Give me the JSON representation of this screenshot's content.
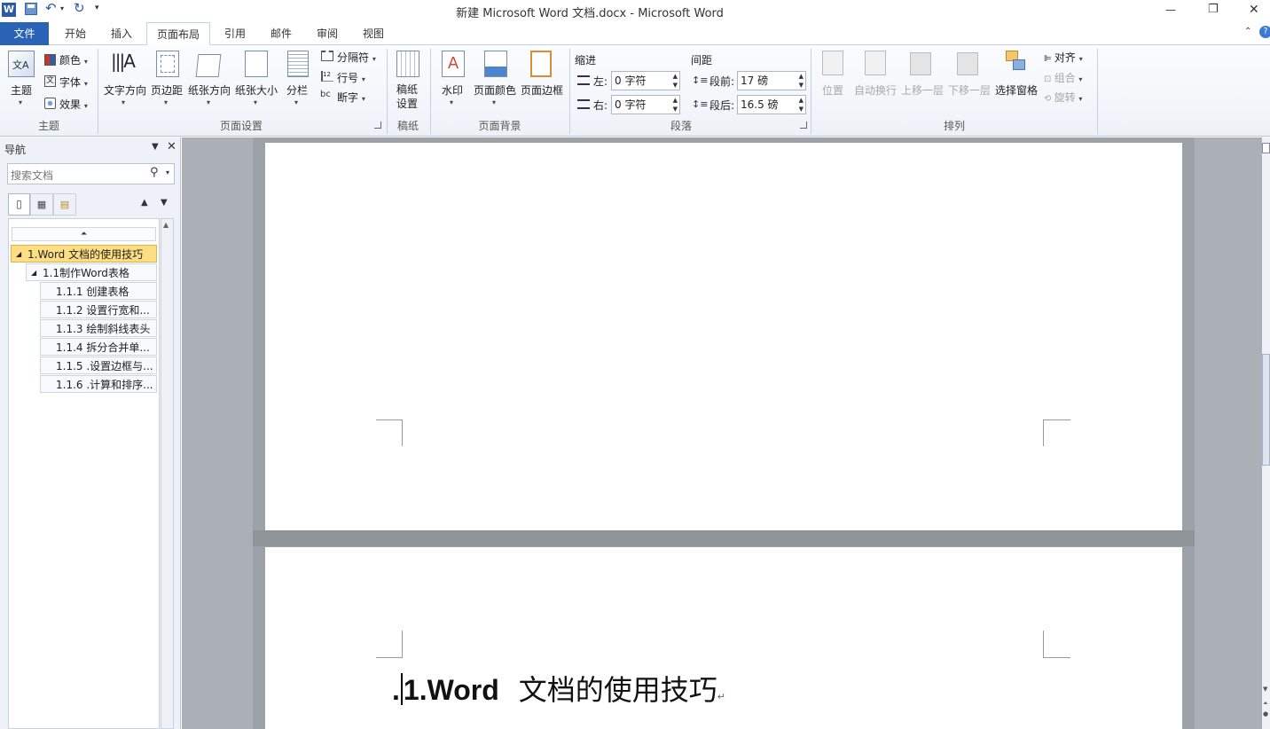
{
  "window": {
    "title": "新建 Microsoft Word 文档.docx  -  Microsoft Word",
    "controls": {
      "minimize": "—",
      "restore": "❐",
      "close": "✕"
    }
  },
  "quick_access": {
    "app_icon": "W",
    "save_icon": "save-icon",
    "undo_icon": "undo-icon",
    "redo_icon": "redo-icon"
  },
  "tabs": [
    "文件",
    "开始",
    "插入",
    "页面布局",
    "引用",
    "邮件",
    "审阅",
    "视图"
  ],
  "ribbon": {
    "theme": {
      "themes": "主题",
      "colors": "颜色",
      "fonts": "字体",
      "effects": "效果",
      "group": "主题"
    },
    "page_setup": {
      "text_direction": "文字方向",
      "margins": "页边距",
      "orientation": "纸张方向",
      "size": "纸张大小",
      "columns": "分栏",
      "breaks": "分隔符",
      "line_numbers": "行号",
      "hyphenation": "断字",
      "group": "页面设置"
    },
    "manuscript": {
      "setup_line1": "稿纸",
      "setup_line2": "设置",
      "group": "稿纸"
    },
    "page_background": {
      "watermark": "水印",
      "page_color": "页面颜色",
      "page_borders": "页面边框",
      "group": "页面背景"
    },
    "paragraph": {
      "indent_title": "缩进",
      "indent_left_label": "左:",
      "indent_left_value": "0 字符",
      "indent_right_label": "右:",
      "indent_right_value": "0 字符",
      "spacing_title": "间距",
      "spacing_before_label": "段前:",
      "spacing_before_value": "17 磅",
      "spacing_after_label": "段后:",
      "spacing_after_value": "16.5 磅",
      "group": "段落"
    },
    "arrange": {
      "position": "位置",
      "wrap_text": "自动换行",
      "bring_forward": "上移一层",
      "send_backward": "下移一层",
      "selection_pane": "选择窗格",
      "align": "对齐",
      "group_objects": "组合",
      "rotate": "旋转",
      "group": "排列"
    }
  },
  "nav_pane": {
    "title": "导航",
    "search_placeholder": "搜索文档",
    "headings": [
      {
        "level": 1,
        "text": "1.Word 文档的使用技巧",
        "selected": true
      },
      {
        "level": 2,
        "text": "1.1制作Word表格",
        "selected": false
      },
      {
        "level": 3,
        "text": "1.1.1 创建表格",
        "selected": false
      },
      {
        "level": 3,
        "text": "1.1.2 设置行宽和...",
        "selected": false
      },
      {
        "level": 3,
        "text": "1.1.3 绘制斜线表头",
        "selected": false
      },
      {
        "level": 3,
        "text": "1.1.4 拆分合并单...",
        "selected": false
      },
      {
        "level": 3,
        "text": "1.1.5 .设置边框与...",
        "selected": false
      },
      {
        "level": 3,
        "text": "1.1.6 .计算和排序...",
        "selected": false
      }
    ]
  },
  "document": {
    "heading_bullet": ".",
    "heading_latin": "1.Word",
    "heading_cjk": "文档的使用技巧",
    "paragraph_mark": "↵"
  }
}
